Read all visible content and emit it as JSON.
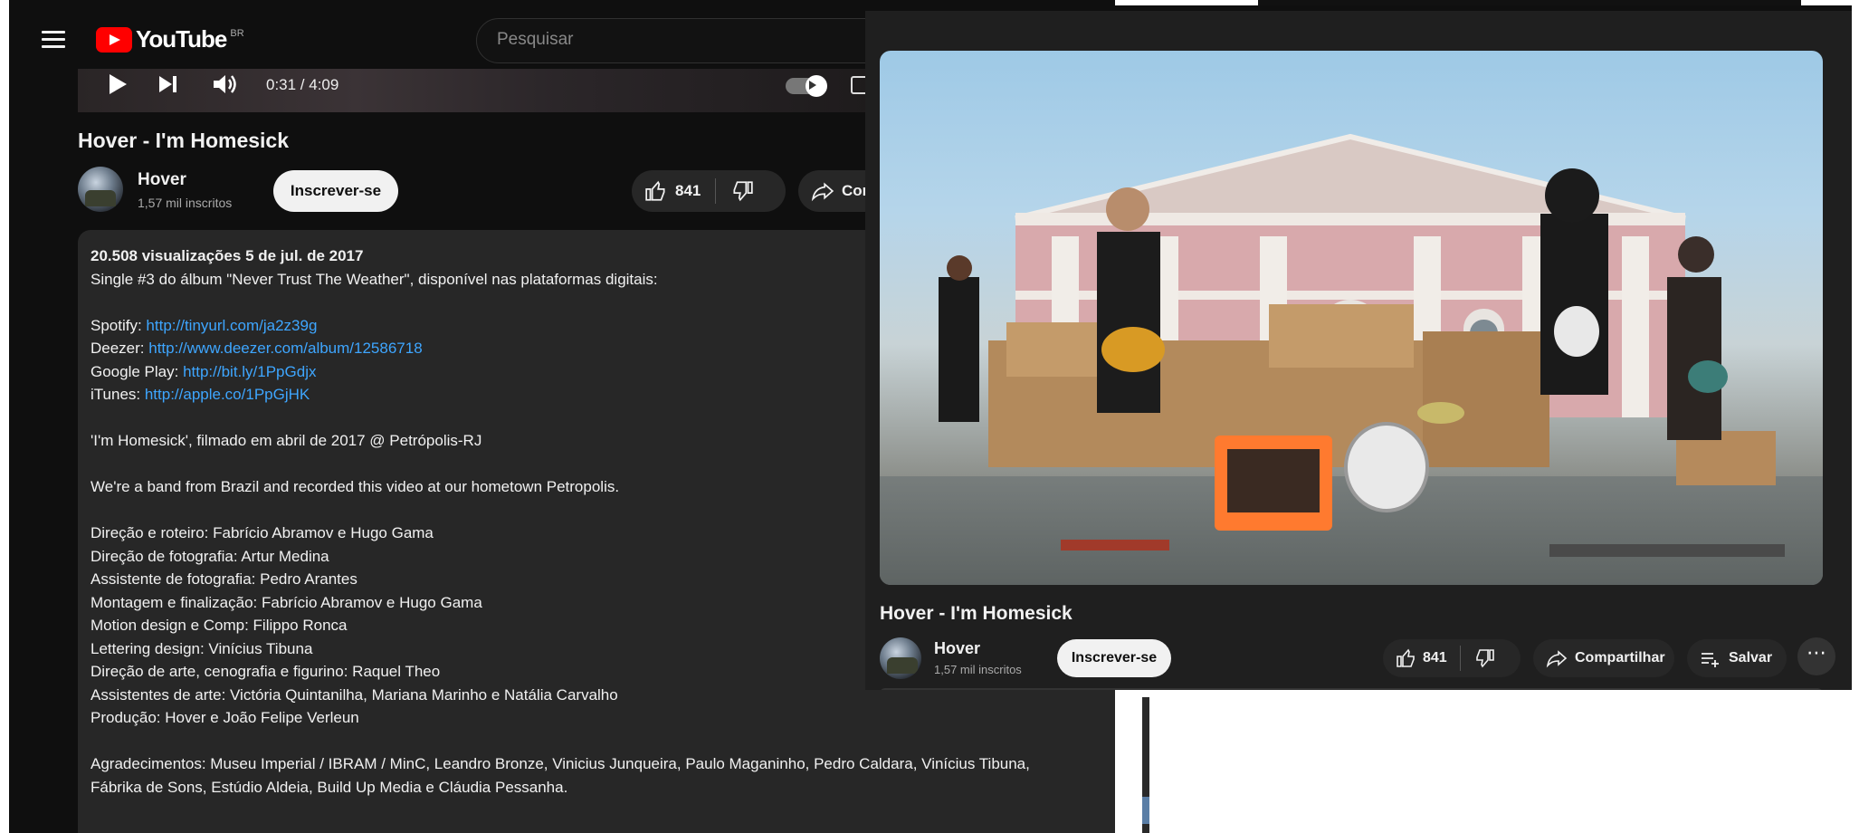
{
  "header": {
    "logo_text": "YouTube",
    "region": "BR",
    "search_placeholder": "Pesquisar"
  },
  "player": {
    "time": "0:31 / 4:09",
    "progress": 0.124
  },
  "left": {
    "title": "Hover - I'm Homesick",
    "channel_name": "Hover",
    "channel_subs": "1,57 mil inscritos",
    "subscribe_label": "Inscrever-se",
    "like_count": "841",
    "share_label": "Com"
  },
  "description": {
    "stats": "20.508 visualizações  5 de jul. de 2017",
    "line1": "Single #3 do álbum \"Never Trust The Weather\", disponível nas plataformas digitais:",
    "spotify_label": "Spotify: ",
    "spotify_url": "http://tinyurl.com/ja2z39g",
    "deezer_label": "Deezer: ",
    "deezer_url": "http://www.deezer.com/album/12586718",
    "gplay_label": "Google Play: ",
    "gplay_url": "http://bit.ly/1PpGdjx",
    "itunes_label": "iTunes: ",
    "itunes_url": "http://apple.co/1PpGjHK",
    "filmed": "'I'm Homesick', filmado em abril de 2017 @ Petrópolis-RJ",
    "band": "We're a band from Brazil and recorded this video at our hometown Petropolis.",
    "credits": [
      "Direção e roteiro: Fabrício Abramov e Hugo Gama",
      "Direção de fotografia: Artur Medina",
      "Assistente de fotografia: Pedro Arantes",
      "Montagem e finalização: Fabrício Abramov e Hugo Gama",
      "Motion design e Comp: Filippo Ronca",
      "Lettering design: Vinícius Tibuna",
      "Direção de arte, cenografia e figurino: Raquel Theo",
      "Assistentes de arte: Victória Quintanilha, Mariana Marinho e Natália Carvalho",
      "Produção: Hover e João Felipe Verleun"
    ],
    "thanks1": "Agradecimentos: Museu Imperial / IBRAM / MinC, Leandro Bronze, Vinicius Junqueira, Paulo Maganinho, Pedro Caldara, Vinícius Tibuna,",
    "thanks2": "Fábrika de Sons, Estúdio Aldeia, Build Up Media e Cláudia Pessanha."
  },
  "right": {
    "title": "Hover - I'm Homesick",
    "channel_name": "Hover",
    "channel_subs": "1,57 mil inscritos",
    "subscribe_label": "Inscrever-se",
    "like_count": "841",
    "share_label": "Compartilhar",
    "save_label": "Salvar",
    "more_label": "⋯"
  },
  "colors": {
    "bg_dark": "#0f0f0f",
    "panel": "#272727",
    "link": "#3ea6ff",
    "brand": "#ff0000"
  }
}
